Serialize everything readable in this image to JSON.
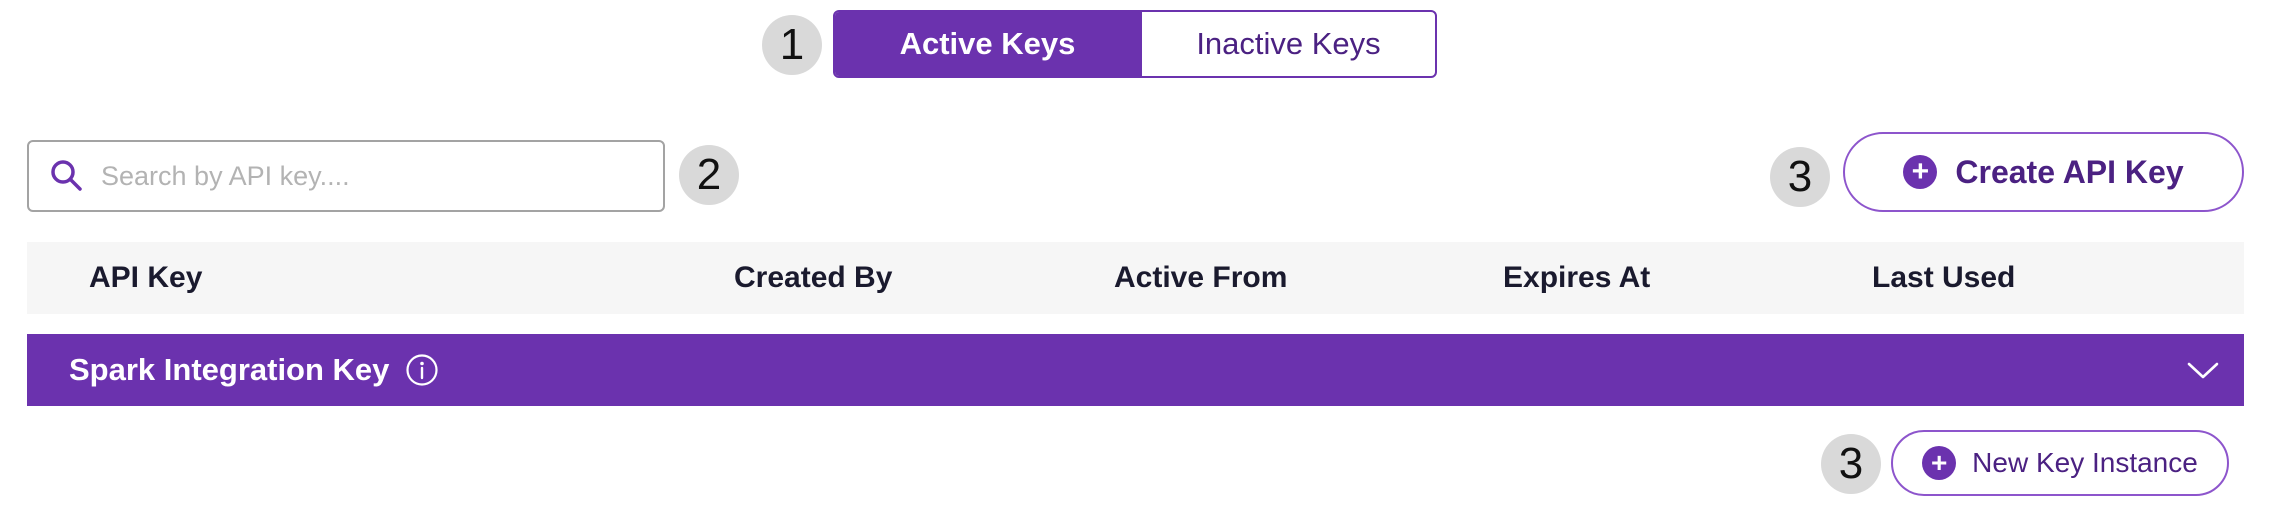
{
  "tabs": {
    "active_label": "Active Keys",
    "inactive_label": "Inactive Keys"
  },
  "search": {
    "placeholder": "Search by API key....",
    "value": ""
  },
  "actions": {
    "create_label": "Create API Key",
    "new_instance_label": "New Key Instance"
  },
  "table": {
    "columns": [
      "API Key",
      "Created By",
      "Active From",
      "Expires At",
      "Last Used"
    ]
  },
  "groups": [
    {
      "title": "Spark Integration Key"
    }
  ],
  "markers": [
    "1",
    "2",
    "3",
    "3"
  ],
  "icons": {
    "search": "search-icon",
    "info": "info-icon",
    "chevron": "chevron-down-icon",
    "plus": "plus-circle-icon"
  },
  "colors": {
    "brand_purple": "#6b32ae",
    "text_dark": "#1a1a2e",
    "header_bg": "#f6f6f6",
    "marker_bg": "#d9d9d9"
  }
}
